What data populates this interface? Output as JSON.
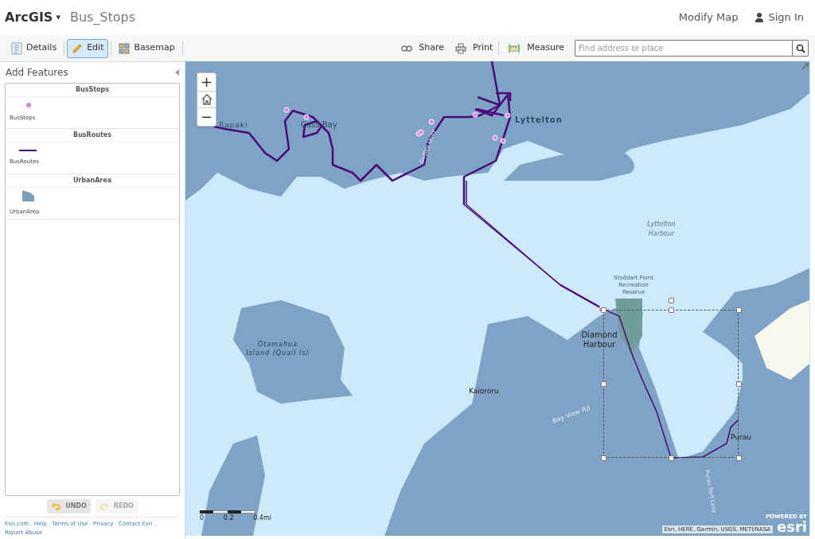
{
  "header": {
    "brand": "ArcGIS",
    "brand_caret": "▾",
    "title": "Bus_Stops",
    "links": [
      {
        "label": "Modify Map",
        "kind": "text"
      },
      {
        "label": "Sign In",
        "kind": "user"
      }
    ]
  },
  "toolbar": {
    "left": [
      {
        "label": "Details",
        "selected": false
      },
      {
        "label": "Edit",
        "selected": true
      },
      {
        "label": "Basemap",
        "selected": false
      }
    ],
    "right": [
      {
        "label": "Share"
      },
      {
        "label": "Print"
      },
      {
        "label": "Measure"
      }
    ],
    "search": {
      "placeholder": "Find address or place"
    }
  },
  "panel": {
    "title": "Add Features",
    "layers": [
      {
        "name": "BusStops",
        "item": "BusStops",
        "kind": "point"
      },
      {
        "name": "BusRoutes",
        "item": "BusRoutes",
        "kind": "line"
      },
      {
        "name": "UrbanArea",
        "item": "UrbanArea",
        "kind": "polygon"
      }
    ],
    "undo": {
      "label": "UNDO",
      "disabled": false
    },
    "redo": {
      "label": "REDO",
      "disabled": true
    },
    "footer": {
      "links": [
        "Esri.com",
        "Help",
        "Terms of Use",
        "Privacy",
        "Contact Esri",
        "Report Abuse"
      ],
      "separator": "."
    }
  },
  "map": {
    "zoom_in": "+",
    "zoom_out": "−",
    "labels": [
      "Rapaki",
      "Cass Bay",
      "Lyttelton",
      "Godley Quay",
      "Lyttelton Harbour",
      "Stoddart Point Recreation Reserve",
      "Diamond Harbour",
      "Otamahua Island (Quail Is)",
      "Kaiororu",
      "Bay View Rd",
      "Purau",
      "Purau Port-Levy"
    ],
    "scale": [
      "0",
      "0.2",
      "0.4mi"
    ],
    "attribution": "Esri, HERE, Garmin, USGS, METI/NASA",
    "powered_by": "POWERED BY",
    "logo": "esri"
  }
}
